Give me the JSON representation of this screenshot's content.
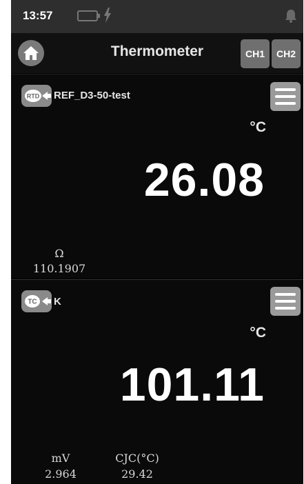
{
  "status_bar": {
    "time": "13:57"
  },
  "header": {
    "home_icon": "home-icon",
    "title": "Thermometer",
    "channel_buttons": [
      "CH1",
      "CH2"
    ]
  },
  "channels": [
    {
      "sensor_badge": "RTD",
      "probe_name": "REF_D3-50-test",
      "unit": "°C",
      "reading": "26.08",
      "aux": [
        {
          "label": "Ω",
          "value": "110.1907"
        }
      ]
    },
    {
      "sensor_badge": "TC",
      "probe_name": "K",
      "unit": "°C",
      "reading": "101.11",
      "aux": [
        {
          "label": "mV",
          "value": "2.964"
        },
        {
          "label": "CJC(°C)",
          "value": "29.42"
        }
      ]
    }
  ],
  "colors": {
    "background": "#000000",
    "statusbar": "#2e2e2e",
    "button": "#6f6f6f",
    "menu_button": "#9a9a9a",
    "text": "#ffffff"
  }
}
